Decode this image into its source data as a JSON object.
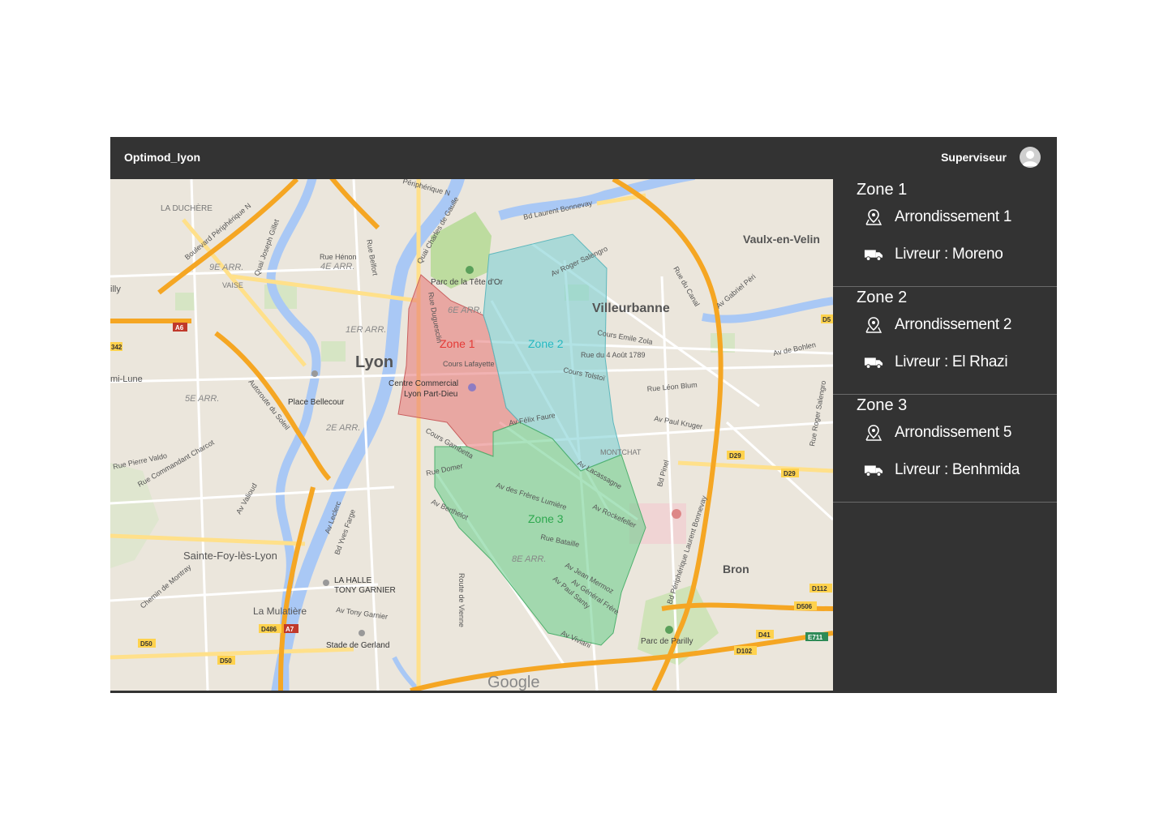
{
  "header": {
    "app_title": "Optimod_lyon",
    "user_role": "Superviseur"
  },
  "colors": {
    "zone1": "#e57373",
    "zone2": "#7fd0d4",
    "zone3": "#66cc88",
    "zone1_label": "#e53935",
    "zone2_label": "#26b8c0",
    "zone3_label": "#2ea84f"
  },
  "map": {
    "zone_labels": [
      "Zone 1",
      "Zone 2",
      "Zone 3"
    ],
    "places": {
      "lyon": "Lyon",
      "villeurbanne": "Villeurbanne",
      "vaulx": "Vaulx-en-Velin",
      "bron": "Bron",
      "sainte_foy": "Sainte-Foy-lès-Lyon",
      "mulatiere": "La Mulatière",
      "duchere": "LA DUCHÈRE",
      "parc_tete_or": "Parc de la Tête d'Or",
      "parc_parilly": "Parc de Parilly",
      "place_bellecour": "Place Bellecour",
      "centre_commercial": "Centre Commercial",
      "part_dieu": "Lyon Part-Dieu",
      "halle_garnier_1": "LA HALLE",
      "halle_garnier_2": "TONY GARNIER",
      "stade_gerland": "Stade de Gerland",
      "montchat": "MONTCHAT",
      "vaise": "VAISE",
      "lune": "mi-Lune",
      "illy": "illy"
    },
    "arrondissements": [
      "9E ARR.",
      "4E ARR.",
      "1ER ARR.",
      "6E ARR.",
      "5E ARR.",
      "2E ARR.",
      "8E ARR."
    ],
    "streets": {
      "cours_lafayette": "Cours Lafayette",
      "cours_emile_zola": "Cours Emile Zola",
      "rue_4_aout": "Rue du 4 Août 1789",
      "cours_tolstoi": "Cours Tolstoï",
      "rue_leon_blum": "Rue Léon Blum",
      "av_paul_kruger": "Av Paul Kruger",
      "av_felix_faure": "Av Félix Faure",
      "av_lacassagne": "Av Lacassagne",
      "av_rockefeller": "Av Rockefeller",
      "rue_bataille": "Rue Bataille",
      "av_jean_mermoz": "Av Jean Mermoz",
      "av_general_frere": "Av Général Frère",
      "av_paul_santy": "Av Paul Santy",
      "av_viviani": "Av Viviani",
      "av_freres_lumiere": "Av des Frères Lumière",
      "av_berthelot": "Av Berthelot",
      "rue_domer": "Rue Domer",
      "cours_gambetta": "Cours Gambetta",
      "rue_duguesclin": "Rue Duguesclin",
      "av_roger_salengro": "Av Roger Salengro",
      "bd_laurent_bonnevay": "Bd Laurent Bonnevay",
      "quai_charles_de_gaulle": "Quai Charles de Gaulle",
      "rue_henon": "Rue Hénon",
      "rue_belfort": "Rue Belfort",
      "quai_joseph_gillet": "Quai Joseph Gillet",
      "bd_peripherique_nord": "Boulevard Périphérique N",
      "autoroute_soleil": "Autoroute du Soleil",
      "rue_pierre_valdo": "Rue Pierre Valdo",
      "rue_commandant_charcot": "Rue Commandant Charcot",
      "av_valioud": "Av Valioud",
      "av_leclerc": "Av Leclerc",
      "bd_yves_farge": "Bd Yves Farge",
      "route_de_vienne": "Route de Vienne",
      "av_tony_garnier": "Av Tony Garnier",
      "chemin_montray": "Chemin de Montray",
      "av_gabriel_peri": "Av Gabriel Péri",
      "rue_du_canal": "Rue du Canal",
      "av_de_bohlen": "Av de Bohlen",
      "rue_roger_salengro": "Rue Roger Salengro",
      "bd_pinel": "Bd Pinel",
      "bd_peripherique_bonnevay": "Bd Périphérique Laurent Bonnevay",
      "peripherique_n": "Périphérique N"
    },
    "road_codes": [
      "A6",
      "D29",
      "D29",
      "D112",
      "D506",
      "D41",
      "D102",
      "E711",
      "D486",
      "A7",
      "D50",
      "D50",
      "D5",
      "342"
    ],
    "attribution": "Google"
  },
  "zones": [
    {
      "title": "Zone 1",
      "arrondissement": "Arrondissement 1",
      "livreur": "Livreur : Moreno"
    },
    {
      "title": "Zone 2",
      "arrondissement": "Arrondissement 2",
      "livreur": "Livreur : El Rhazi"
    },
    {
      "title": "Zone 3",
      "arrondissement": "Arrondissement 5",
      "livreur": "Livreur : Benhmida"
    }
  ]
}
